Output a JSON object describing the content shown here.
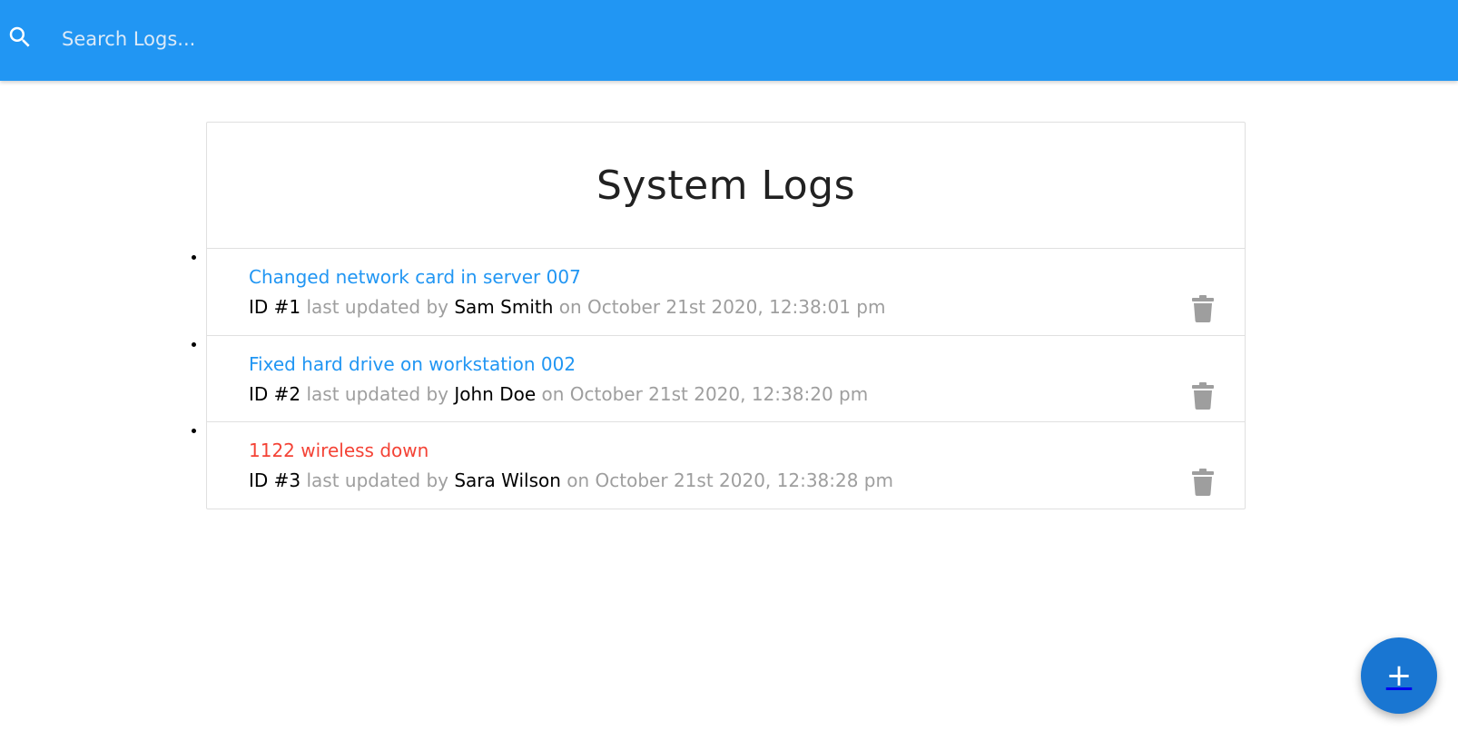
{
  "search": {
    "placeholder": "Search Logs...",
    "icon": "search-icon"
  },
  "main": {
    "title": "System Logs",
    "logs": [
      {
        "message": "Changed network card in server 007",
        "attention": false,
        "id_label": "ID #1",
        "updated_by_text": " last updated by ",
        "tech": "Sam Smith",
        "date_text": " on October 21st 2020, 12:38:01 pm"
      },
      {
        "message": "Fixed hard drive on workstation 002",
        "attention": false,
        "id_label": "ID #2",
        "updated_by_text": " last updated by ",
        "tech": "John Doe",
        "date_text": " on October 21st 2020, 12:38:20 pm"
      },
      {
        "message": "1122 wireless down",
        "attention": true,
        "id_label": "ID #3",
        "updated_by_text": " last updated by ",
        "tech": "Sara Wilson",
        "date_text": " on October 21st 2020, 12:38:28 pm"
      }
    ]
  },
  "fab": {
    "label": "+",
    "icon": "add-icon"
  },
  "colors": {
    "navbar": "#2196f3",
    "link": "#2196f3",
    "attention": "#f44336",
    "muted": "#9e9e9e",
    "fab": "#1976d2",
    "delete_icon": "#9e9e9e"
  }
}
